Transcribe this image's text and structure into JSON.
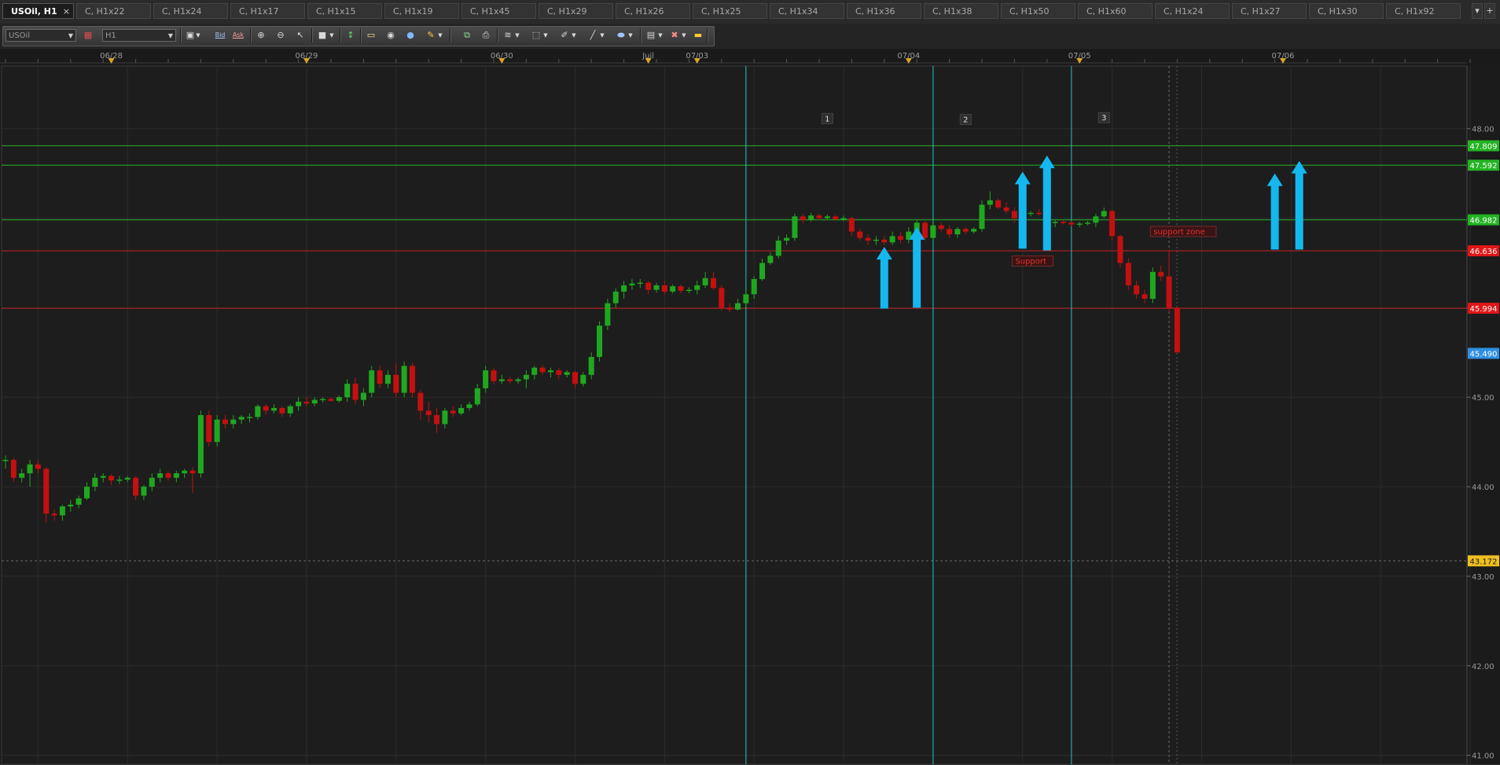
{
  "tabs": [
    {
      "label": "USOil, H1",
      "active": true,
      "close": "×"
    },
    {
      "label": "C, H1x22"
    },
    {
      "label": "C, H1x24"
    },
    {
      "label": "C, H1x17"
    },
    {
      "label": "C, H1x15"
    },
    {
      "label": "C, H1x19"
    },
    {
      "label": "C, H1x45"
    },
    {
      "label": "C, H1x29"
    },
    {
      "label": "C, H1x26"
    },
    {
      "label": "C, H1x25"
    },
    {
      "label": "C, H1x34"
    },
    {
      "label": "C, H1x36"
    },
    {
      "label": "C, H1x38"
    },
    {
      "label": "C, H1x50"
    },
    {
      "label": "C, H1x60"
    },
    {
      "label": "C, H1x24"
    },
    {
      "label": "C, H1x27"
    },
    {
      "label": "C, H1x30"
    },
    {
      "label": "C, H1x92"
    }
  ],
  "tabbar_buttons": {
    "scroll": "▾",
    "add": "+"
  },
  "toolbar": {
    "symbol_value": "USOil",
    "timeframe_value": "H1",
    "bid_label": "Bid",
    "ask_label": "Ask",
    "icons": [
      "chart-type-icon",
      "bid-icon",
      "ask-icon",
      "zoom-in-icon",
      "zoom-out-icon",
      "cursor-icon",
      "crosshair-icon",
      "trend-icon",
      "comment-icon",
      "eye-icon",
      "globe-icon",
      "ruler-icon",
      "layers-icon",
      "print-icon",
      "fibonacci-icon",
      "rectangle-icon",
      "pencil-icon",
      "line-icon",
      "ellipse-icon",
      "grid-icon",
      "eraser-icon",
      "more-icon"
    ]
  },
  "colors": {
    "bull": "#1fa81f",
    "bear": "#c41010",
    "grid": "#2c2c2c",
    "resistance_line": "#29b629",
    "support_line": "#c42121",
    "vertical_line": "#24c4c4",
    "arrow": "#14b8ee",
    "label_green": "#23b323",
    "label_red": "#e01616",
    "label_blue": "#2e8fe0",
    "label_yellow": "#f0c020"
  },
  "chart_data": {
    "type": "candlestick",
    "symbol": "USOil",
    "timeframe": "H1",
    "ylim": [
      40.9,
      48.7
    ],
    "y_ticks": [
      "48.00",
      "47.00",
      "46.00",
      "45.00",
      "44.00",
      "43.00",
      "42.00",
      "41.00"
    ],
    "date_labels": [
      {
        "label": "06/28",
        "bar": 13,
        "marker": true
      },
      {
        "label": "06/29",
        "bar": 37,
        "marker": true
      },
      {
        "label": "06/30",
        "bar": 61,
        "marker": true
      },
      {
        "label": "Juil",
        "bar": 79,
        "marker": true
      },
      {
        "label": "07/03",
        "bar": 85,
        "marker": true
      },
      {
        "label": "07/04",
        "bar": 111,
        "marker": true
      },
      {
        "label": "07/05",
        "bar": 132,
        "marker": true
      },
      {
        "label": "07/06",
        "bar": 157,
        "marker": true
      }
    ],
    "bars_visible": 183,
    "candles": [
      {
        "o": 44.3,
        "h": 44.35,
        "l": 44.2,
        "c": 44.3
      },
      {
        "o": 44.3,
        "h": 44.32,
        "l": 44.05,
        "c": 44.1
      },
      {
        "o": 44.1,
        "h": 44.2,
        "l": 44.05,
        "c": 44.15
      },
      {
        "o": 44.15,
        "h": 44.3,
        "l": 44.0,
        "c": 44.25
      },
      {
        "o": 44.25,
        "h": 44.3,
        "l": 44.15,
        "c": 44.2
      },
      {
        "o": 44.2,
        "h": 44.22,
        "l": 43.6,
        "c": 43.7
      },
      {
        "o": 43.7,
        "h": 43.75,
        "l": 43.62,
        "c": 43.68
      },
      {
        "o": 43.68,
        "h": 43.8,
        "l": 43.62,
        "c": 43.78
      },
      {
        "o": 43.78,
        "h": 43.85,
        "l": 43.72,
        "c": 43.8
      },
      {
        "o": 43.8,
        "h": 43.9,
        "l": 43.76,
        "c": 43.87
      },
      {
        "o": 43.87,
        "h": 44.05,
        "l": 43.85,
        "c": 44.0
      },
      {
        "o": 44.0,
        "h": 44.15,
        "l": 43.95,
        "c": 44.1
      },
      {
        "o": 44.1,
        "h": 44.15,
        "l": 44.05,
        "c": 44.12
      },
      {
        "o": 44.12,
        "h": 44.14,
        "l": 44.02,
        "c": 44.07
      },
      {
        "o": 44.07,
        "h": 44.12,
        "l": 44.03,
        "c": 44.08
      },
      {
        "o": 44.08,
        "h": 44.12,
        "l": 44.05,
        "c": 44.1
      },
      {
        "o": 44.1,
        "h": 44.12,
        "l": 43.85,
        "c": 43.9
      },
      {
        "o": 43.9,
        "h": 44.02,
        "l": 43.85,
        "c": 44.0
      },
      {
        "o": 44.0,
        "h": 44.15,
        "l": 43.95,
        "c": 44.1
      },
      {
        "o": 44.1,
        "h": 44.2,
        "l": 44.05,
        "c": 44.15
      },
      {
        "o": 44.15,
        "h": 44.17,
        "l": 44.07,
        "c": 44.1
      },
      {
        "o": 44.1,
        "h": 44.18,
        "l": 44.05,
        "c": 44.15
      },
      {
        "o": 44.15,
        "h": 44.2,
        "l": 44.1,
        "c": 44.18
      },
      {
        "o": 44.18,
        "h": 44.22,
        "l": 43.93,
        "c": 44.15
      },
      {
        "o": 44.15,
        "h": 44.85,
        "l": 44.1,
        "c": 44.8
      },
      {
        "o": 44.8,
        "h": 44.85,
        "l": 44.45,
        "c": 44.5
      },
      {
        "o": 44.5,
        "h": 44.8,
        "l": 44.45,
        "c": 44.75
      },
      {
        "o": 44.75,
        "h": 44.8,
        "l": 44.65,
        "c": 44.7
      },
      {
        "o": 44.7,
        "h": 44.8,
        "l": 44.65,
        "c": 44.75
      },
      {
        "o": 44.75,
        "h": 44.8,
        "l": 44.7,
        "c": 44.78
      },
      {
        "o": 44.78,
        "h": 44.82,
        "l": 44.72,
        "c": 44.78
      },
      {
        "o": 44.78,
        "h": 44.92,
        "l": 44.75,
        "c": 44.9
      },
      {
        "o": 44.9,
        "h": 44.92,
        "l": 44.8,
        "c": 44.85
      },
      {
        "o": 44.85,
        "h": 44.92,
        "l": 44.82,
        "c": 44.88
      },
      {
        "o": 44.88,
        "h": 44.9,
        "l": 44.78,
        "c": 44.82
      },
      {
        "o": 44.82,
        "h": 44.92,
        "l": 44.78,
        "c": 44.9
      },
      {
        "o": 44.9,
        "h": 45.0,
        "l": 44.85,
        "c": 44.95
      },
      {
        "o": 44.95,
        "h": 45.0,
        "l": 44.9,
        "c": 44.93
      },
      {
        "o": 44.93,
        "h": 45.0,
        "l": 44.9,
        "c": 44.97
      },
      {
        "o": 44.97,
        "h": 45.0,
        "l": 44.94,
        "c": 44.98
      },
      {
        "o": 44.98,
        "h": 45.0,
        "l": 44.95,
        "c": 44.96
      },
      {
        "o": 44.96,
        "h": 45.02,
        "l": 44.94,
        "c": 45.0
      },
      {
        "o": 45.0,
        "h": 45.2,
        "l": 44.95,
        "c": 45.15
      },
      {
        "o": 45.15,
        "h": 45.22,
        "l": 44.92,
        "c": 44.97
      },
      {
        "o": 44.97,
        "h": 45.1,
        "l": 44.9,
        "c": 45.05
      },
      {
        "o": 45.05,
        "h": 45.35,
        "l": 45.0,
        "c": 45.3
      },
      {
        "o": 45.3,
        "h": 45.35,
        "l": 45.1,
        "c": 45.15
      },
      {
        "o": 45.15,
        "h": 45.3,
        "l": 45.1,
        "c": 45.25
      },
      {
        "o": 45.25,
        "h": 45.38,
        "l": 45.0,
        "c": 45.05
      },
      {
        "o": 45.05,
        "h": 45.4,
        "l": 45.0,
        "c": 45.35
      },
      {
        "o": 45.35,
        "h": 45.38,
        "l": 45.0,
        "c": 45.05
      },
      {
        "o": 45.05,
        "h": 45.08,
        "l": 44.75,
        "c": 44.85
      },
      {
        "o": 44.85,
        "h": 44.95,
        "l": 44.72,
        "c": 44.8
      },
      {
        "o": 44.8,
        "h": 44.88,
        "l": 44.6,
        "c": 44.7
      },
      {
        "o": 44.7,
        "h": 44.88,
        "l": 44.65,
        "c": 44.85
      },
      {
        "o": 44.85,
        "h": 44.9,
        "l": 44.78,
        "c": 44.82
      },
      {
        "o": 44.82,
        "h": 44.92,
        "l": 44.8,
        "c": 44.88
      },
      {
        "o": 44.88,
        "h": 44.95,
        "l": 44.85,
        "c": 44.92
      },
      {
        "o": 44.92,
        "h": 45.15,
        "l": 44.9,
        "c": 45.1
      },
      {
        "o": 45.1,
        "h": 45.35,
        "l": 45.05,
        "c": 45.3
      },
      {
        "o": 45.3,
        "h": 45.33,
        "l": 45.15,
        "c": 45.18
      },
      {
        "o": 45.18,
        "h": 45.25,
        "l": 45.15,
        "c": 45.2
      },
      {
        "o": 45.2,
        "h": 45.23,
        "l": 45.15,
        "c": 45.18
      },
      {
        "o": 45.18,
        "h": 45.22,
        "l": 45.15,
        "c": 45.2
      },
      {
        "o": 45.2,
        "h": 45.3,
        "l": 45.1,
        "c": 45.25
      },
      {
        "o": 45.25,
        "h": 45.35,
        "l": 45.2,
        "c": 45.33
      },
      {
        "o": 45.33,
        "h": 45.36,
        "l": 45.25,
        "c": 45.28
      },
      {
        "o": 45.28,
        "h": 45.33,
        "l": 45.22,
        "c": 45.3
      },
      {
        "o": 45.3,
        "h": 45.33,
        "l": 45.2,
        "c": 45.25
      },
      {
        "o": 45.25,
        "h": 45.3,
        "l": 45.22,
        "c": 45.28
      },
      {
        "o": 45.28,
        "h": 45.3,
        "l": 45.1,
        "c": 45.15
      },
      {
        "o": 45.15,
        "h": 45.28,
        "l": 45.12,
        "c": 45.25
      },
      {
        "o": 45.25,
        "h": 45.5,
        "l": 45.2,
        "c": 45.45
      },
      {
        "o": 45.45,
        "h": 45.85,
        "l": 45.4,
        "c": 45.8
      },
      {
        "o": 45.8,
        "h": 46.1,
        "l": 45.75,
        "c": 46.05
      },
      {
        "o": 46.05,
        "h": 46.22,
        "l": 46.0,
        "c": 46.18
      },
      {
        "o": 46.18,
        "h": 46.3,
        "l": 46.1,
        "c": 46.25
      },
      {
        "o": 46.25,
        "h": 46.32,
        "l": 46.2,
        "c": 46.27
      },
      {
        "o": 46.27,
        "h": 46.32,
        "l": 46.22,
        "c": 46.28
      },
      {
        "o": 46.28,
        "h": 46.3,
        "l": 46.15,
        "c": 46.2
      },
      {
        "o": 46.2,
        "h": 46.28,
        "l": 46.17,
        "c": 46.25
      },
      {
        "o": 46.25,
        "h": 46.3,
        "l": 46.15,
        "c": 46.18
      },
      {
        "o": 46.18,
        "h": 46.26,
        "l": 46.16,
        "c": 46.24
      },
      {
        "o": 46.24,
        "h": 46.26,
        "l": 46.16,
        "c": 46.19
      },
      {
        "o": 46.19,
        "h": 46.23,
        "l": 46.16,
        "c": 46.2
      },
      {
        "o": 46.2,
        "h": 46.3,
        "l": 46.15,
        "c": 46.25
      },
      {
        "o": 46.25,
        "h": 46.4,
        "l": 46.22,
        "c": 46.33
      },
      {
        "o": 46.33,
        "h": 46.4,
        "l": 46.2,
        "c": 46.22
      },
      {
        "o": 46.22,
        "h": 46.25,
        "l": 45.97,
        "c": 46.0
      },
      {
        "o": 46.0,
        "h": 46.05,
        "l": 45.95,
        "c": 45.98
      },
      {
        "o": 45.98,
        "h": 46.1,
        "l": 45.97,
        "c": 46.05
      },
      {
        "o": 46.05,
        "h": 46.2,
        "l": 46.0,
        "c": 46.15
      },
      {
        "o": 46.15,
        "h": 46.35,
        "l": 46.1,
        "c": 46.32
      },
      {
        "o": 46.32,
        "h": 46.55,
        "l": 46.3,
        "c": 46.5
      },
      {
        "o": 46.5,
        "h": 46.62,
        "l": 46.48,
        "c": 46.58
      },
      {
        "o": 46.58,
        "h": 46.8,
        "l": 46.55,
        "c": 46.75
      },
      {
        "o": 46.75,
        "h": 46.82,
        "l": 46.7,
        "c": 46.78
      },
      {
        "o": 46.78,
        "h": 47.05,
        "l": 46.75,
        "c": 47.02
      },
      {
        "o": 47.02,
        "h": 47.05,
        "l": 46.95,
        "c": 46.98
      },
      {
        "o": 46.98,
        "h": 47.06,
        "l": 46.96,
        "c": 47.03
      },
      {
        "o": 47.03,
        "h": 47.05,
        "l": 46.98,
        "c": 47.0
      },
      {
        "o": 47.0,
        "h": 47.04,
        "l": 46.98,
        "c": 47.02
      },
      {
        "o": 47.02,
        "h": 47.04,
        "l": 46.97,
        "c": 46.99
      },
      {
        "o": 46.99,
        "h": 47.03,
        "l": 46.97,
        "c": 47.0
      },
      {
        "o": 47.0,
        "h": 47.02,
        "l": 46.8,
        "c": 46.85
      },
      {
        "o": 46.85,
        "h": 46.88,
        "l": 46.75,
        "c": 46.78
      },
      {
        "o": 46.78,
        "h": 46.82,
        "l": 46.7,
        "c": 46.75
      },
      {
        "o": 46.75,
        "h": 46.8,
        "l": 46.7,
        "c": 46.76
      },
      {
        "o": 46.76,
        "h": 46.8,
        "l": 46.7,
        "c": 46.73
      },
      {
        "o": 46.73,
        "h": 46.85,
        "l": 46.7,
        "c": 46.8
      },
      {
        "o": 46.8,
        "h": 46.85,
        "l": 46.72,
        "c": 46.76
      },
      {
        "o": 46.76,
        "h": 46.9,
        "l": 46.72,
        "c": 46.85
      },
      {
        "o": 46.85,
        "h": 46.98,
        "l": 46.8,
        "c": 46.95
      },
      {
        "o": 46.95,
        "h": 46.97,
        "l": 46.75,
        "c": 46.78
      },
      {
        "o": 46.78,
        "h": 46.95,
        "l": 46.75,
        "c": 46.92
      },
      {
        "o": 46.92,
        "h": 46.95,
        "l": 46.85,
        "c": 46.88
      },
      {
        "o": 46.88,
        "h": 46.92,
        "l": 46.78,
        "c": 46.82
      },
      {
        "o": 46.82,
        "h": 46.9,
        "l": 46.78,
        "c": 46.88
      },
      {
        "o": 46.88,
        "h": 46.9,
        "l": 46.82,
        "c": 46.85
      },
      {
        "o": 46.85,
        "h": 46.9,
        "l": 46.83,
        "c": 46.88
      },
      {
        "o": 46.88,
        "h": 47.2,
        "l": 46.85,
        "c": 47.15
      },
      {
        "o": 47.15,
        "h": 47.3,
        "l": 47.1,
        "c": 47.2
      },
      {
        "o": 47.2,
        "h": 47.22,
        "l": 47.1,
        "c": 47.12
      },
      {
        "o": 47.12,
        "h": 47.18,
        "l": 47.05,
        "c": 47.08
      },
      {
        "o": 47.08,
        "h": 47.12,
        "l": 46.95,
        "c": 47.0
      },
      {
        "o": 47.0,
        "h": 47.06,
        "l": 46.98,
        "c": 47.05
      },
      {
        "o": 47.05,
        "h": 47.08,
        "l": 47.02,
        "c": 47.06
      },
      {
        "o": 47.06,
        "h": 47.1,
        "l": 47.03,
        "c": 47.05
      },
      {
        "o": 47.05,
        "h": 47.08,
        "l": 46.9,
        "c": 46.95
      },
      {
        "o": 46.95,
        "h": 46.98,
        "l": 46.9,
        "c": 46.96
      },
      {
        "o": 46.96,
        "h": 46.98,
        "l": 46.93,
        "c": 46.95
      },
      {
        "o": 46.95,
        "h": 46.97,
        "l": 46.91,
        "c": 46.93
      },
      {
        "o": 46.93,
        "h": 46.96,
        "l": 46.9,
        "c": 46.94
      },
      {
        "o": 46.94,
        "h": 46.97,
        "l": 46.92,
        "c": 46.95
      },
      {
        "o": 46.95,
        "h": 47.05,
        "l": 46.9,
        "c": 47.02
      },
      {
        "o": 47.02,
        "h": 47.12,
        "l": 47.0,
        "c": 47.08
      },
      {
        "o": 47.08,
        "h": 47.1,
        "l": 46.75,
        "c": 46.8
      },
      {
        "o": 46.8,
        "h": 46.82,
        "l": 46.45,
        "c": 46.5
      },
      {
        "o": 46.5,
        "h": 46.55,
        "l": 46.2,
        "c": 46.25
      },
      {
        "o": 46.25,
        "h": 46.3,
        "l": 46.1,
        "c": 46.15
      },
      {
        "o": 46.15,
        "h": 46.2,
        "l": 46.05,
        "c": 46.1
      },
      {
        "o": 46.1,
        "h": 46.45,
        "l": 46.05,
        "c": 46.4
      },
      {
        "o": 46.4,
        "h": 46.47,
        "l": 46.3,
        "c": 46.35
      },
      {
        "o": 46.35,
        "h": 46.65,
        "l": 45.95,
        "c": 46.0
      },
      {
        "o": 46.0,
        "h": 46.02,
        "l": 45.5,
        "c": 45.5
      }
    ],
    "horizontal_lines": [
      {
        "price": 47.809,
        "color": "green"
      },
      {
        "price": 47.592,
        "color": "green"
      },
      {
        "price": 46.982,
        "color": "green"
      },
      {
        "price": 46.636,
        "color": "red"
      },
      {
        "price": 45.994,
        "color": "red"
      }
    ],
    "price_labels": [
      {
        "text": "47.809",
        "price": 47.809,
        "color": "green"
      },
      {
        "text": "47.592",
        "price": 47.592,
        "color": "green"
      },
      {
        "text": "46.982",
        "price": 46.982,
        "color": "green"
      },
      {
        "text": "46.636",
        "price": 46.636,
        "color": "red"
      },
      {
        "text": "45.994",
        "price": 45.994,
        "color": "red"
      },
      {
        "text": "45.490",
        "price": 45.49,
        "color": "blue"
      },
      {
        "text": "43.172",
        "price": 43.172,
        "color": "yellow"
      }
    ],
    "dashed_horizontal": {
      "price": 43.172
    },
    "dashed_vertical": {
      "bar": 143
    },
    "vertical_lines": [
      {
        "bar": 91,
        "label": ""
      },
      {
        "bar": 114,
        "label": ""
      },
      {
        "bar": 131,
        "label": ""
      }
    ],
    "sections": [
      {
        "label": "1",
        "bar": 101,
        "price": 48.1
      },
      {
        "label": "2",
        "bar": 118,
        "price": 48.09
      },
      {
        "label": "3",
        "bar": 135,
        "price": 48.11
      }
    ],
    "annotations": [
      {
        "text": "Support",
        "bar": 124,
        "price": 46.5
      },
      {
        "text": "support zone",
        "bar": 141,
        "price": 46.83
      }
    ],
    "arrows": [
      {
        "bar": 108,
        "from": 45.99,
        "to": 46.68
      },
      {
        "bar": 112,
        "from": 46.0,
        "to": 46.9
      },
      {
        "bar": 125,
        "from": 46.66,
        "to": 47.52
      },
      {
        "bar": 128,
        "from": 46.64,
        "to": 47.7
      },
      {
        "bar": 156,
        "from": 46.65,
        "to": 47.5
      },
      {
        "bar": 159,
        "from": 46.65,
        "to": 47.64
      }
    ]
  }
}
